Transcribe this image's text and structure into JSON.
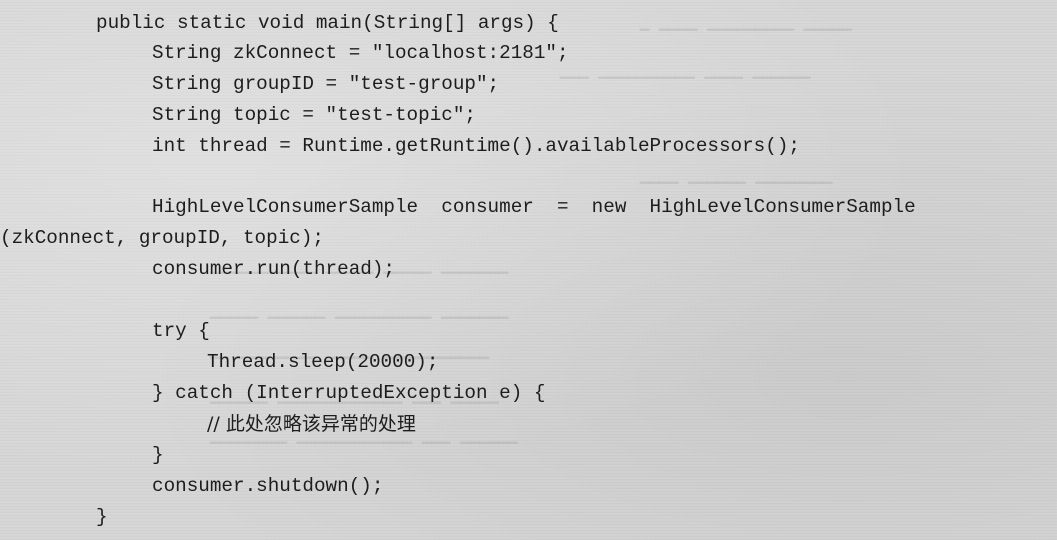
{
  "code": {
    "lines": [
      "public static void main(String[] args) {",
      "String zkConnect = \"localhost:2181\";",
      "String groupID = \"test-group\";",
      "String topic = \"test-topic\";",
      "int thread = Runtime.getRuntime().availableProcessors();",
      "HighLevelConsumerSample  consumer  =  new  HighLevelConsumerSample",
      "(zkConnect, groupID, topic);",
      "consumer.run(thread);",
      "try {",
      "Thread.sleep(20000);",
      "} catch (InterruptedException e) {",
      "// 此处忽略该异常的处理",
      "}",
      "consumer.shutdown();",
      "}"
    ]
  }
}
